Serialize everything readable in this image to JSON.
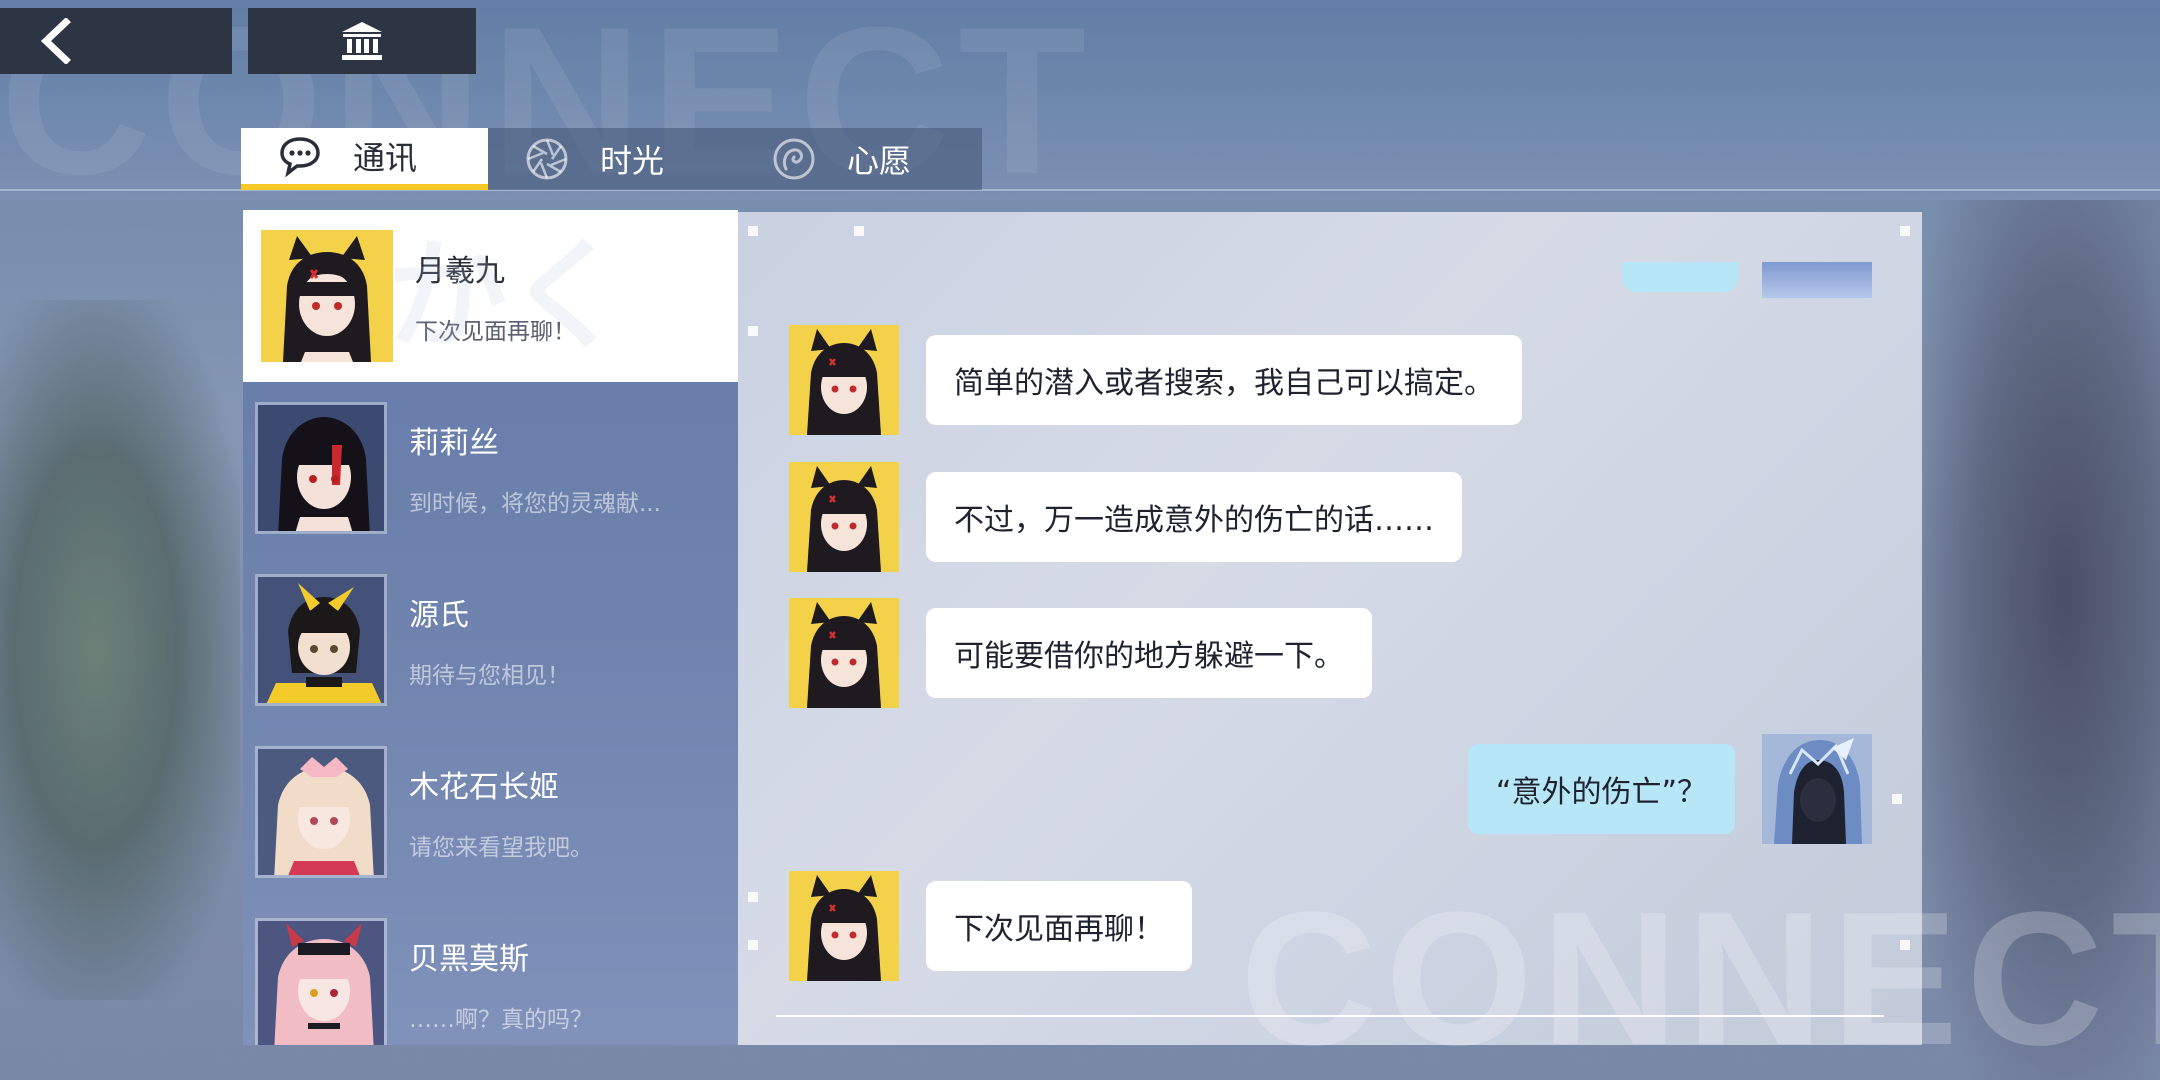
{
  "top_bar": {
    "back_icon": "chevron-left-icon",
    "museum_icon": "museum-icon"
  },
  "watermark": {
    "top": "CONNECT",
    "bottom": "CONNECT"
  },
  "tabs": [
    {
      "label": "通讯",
      "icon": "chat-bubble-icon",
      "active": true
    },
    {
      "label": "时光",
      "icon": "aperture-icon",
      "active": false
    },
    {
      "label": "心愿",
      "icon": "wish-spiral-icon",
      "active": false
    }
  ],
  "contacts": [
    {
      "name": "月羲九",
      "last_message": "下次见面再聊！",
      "active": true
    },
    {
      "name": "莉莉丝",
      "last_message": "到时候，将您的灵魂献...",
      "active": false
    },
    {
      "name": "源氏",
      "last_message": "期待与您相见！",
      "active": false
    },
    {
      "name": "木花石长姬",
      "last_message": "请您来看望我吧。",
      "active": false
    },
    {
      "name": "贝黑莫斯",
      "last_message": "……啊？真的吗？",
      "active": false
    }
  ],
  "contact_watermark": "かく",
  "chat": {
    "messages": [
      {
        "sender": "月羲九",
        "side": "left",
        "text": "简单的潜入或者搜索，我自己可以搞定。"
      },
      {
        "sender": "月羲九",
        "side": "left",
        "text": "不过，万一造成意外的伤亡的话……"
      },
      {
        "sender": "月羲九",
        "side": "left",
        "text": "可能要借你的地方躲避一下。"
      },
      {
        "sender": "player",
        "side": "right",
        "text": "“意外的伤亡”？"
      },
      {
        "sender": "月羲九",
        "side": "left",
        "text": "下次见面再聊！"
      }
    ]
  },
  "colors": {
    "tab_accent": "#f6c828",
    "player_bubble": "#b7e7f6",
    "npc_bubble": "#ffffff",
    "top_button_bg": "#2d3444"
  }
}
